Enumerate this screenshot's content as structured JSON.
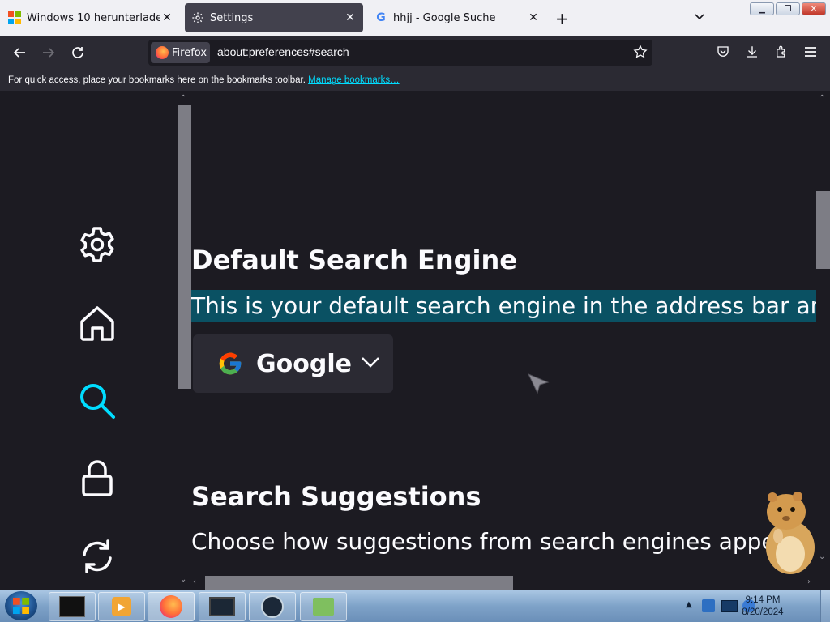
{
  "tabs": [
    {
      "title": "Windows 10 herunterladen",
      "favicon": "windows-logo-icon"
    },
    {
      "title": "Settings",
      "favicon": "gear-icon",
      "active": true
    },
    {
      "title": "hhjj - Google Suche",
      "favicon": "google-g-icon"
    }
  ],
  "toolbar": {
    "identity_label": "Firefox",
    "url": "about:preferences#search"
  },
  "bookmarks_bar": {
    "message": "For quick access, place your bookmarks here on the bookmarks toolbar.",
    "manage_link": "Manage bookmarks…"
  },
  "sidebar": {
    "categories": [
      "gear-icon",
      "home-icon",
      "search-icon",
      "lock-icon",
      "sync-icon"
    ],
    "selected": "search-icon"
  },
  "main": {
    "default_engine": {
      "heading": "Default Search Engine",
      "description": "This is your default search engine in the address bar and se",
      "selected_engine": "Google"
    },
    "suggestions": {
      "heading": "Search Suggestions",
      "description": "Choose how suggestions from search engines appear."
    }
  },
  "taskbar": {
    "time": "9:14 PM",
    "date": "8/20/2024"
  },
  "colors": {
    "accent": "#00ddff",
    "highlight": "#0a5163",
    "background": "#1c1b22"
  }
}
